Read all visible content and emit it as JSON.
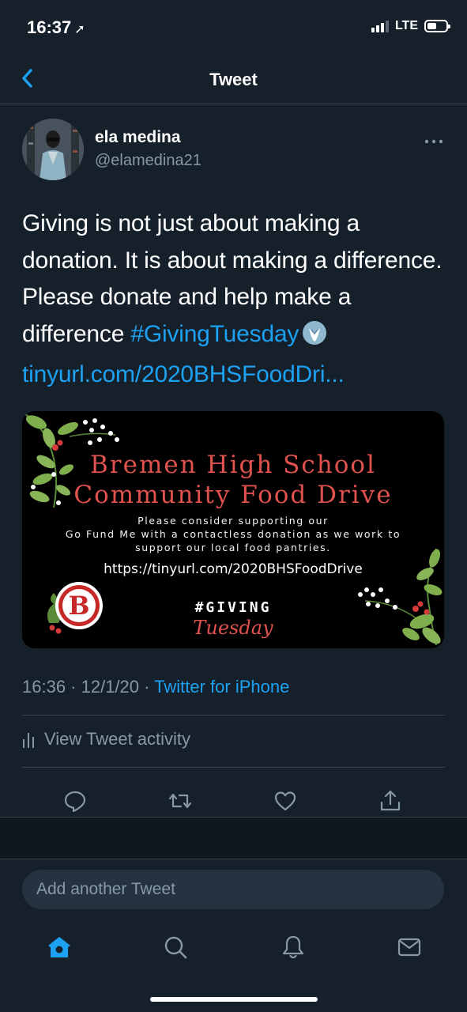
{
  "status_bar": {
    "time": "16:37",
    "network": "LTE"
  },
  "nav": {
    "title": "Tweet"
  },
  "tweet": {
    "author_name": "ela medina",
    "author_handle": "@elamedina21",
    "text_plain": "Giving is not just about making a donation. It is about making a difference. Please donate and help make a difference ",
    "hashtag": "#GivingTuesday",
    "link": "tinyurl.com/2020BHSFoodDri...",
    "timestamp": "16:36 · 12/1/20 · ",
    "source": "Twitter for iPhone",
    "activity_label": "View Tweet activity"
  },
  "media_card": {
    "headline_line1": "Bremen High School",
    "headline_line2": "Community Food Drive",
    "body_line1": "Please consider supporting our",
    "body_line2": "Go Fund Me with a contactless donation as we work to",
    "body_line3": "support our local food pantries.",
    "url": "https://tinyurl.com/2020BHSFoodDrive",
    "hashtag": "#GIVING",
    "tuesday": "Tuesday",
    "logo_letter": "B"
  },
  "reply": {
    "placeholder": "Add another Tweet"
  },
  "colors": {
    "background": "#15202b",
    "accent": "#1da1f2",
    "secondary_text": "#8899a6",
    "card_red": "#e0524e"
  },
  "icons": {
    "back": "chevron-left-icon",
    "more": "more-horizontal-icon",
    "reply": "reply-icon",
    "retweet": "retweet-icon",
    "like": "heart-icon",
    "share": "share-icon",
    "activity": "bar-chart-icon",
    "tab_home": "home-icon",
    "tab_search": "search-icon",
    "tab_notifications": "bell-icon",
    "tab_messages": "mail-icon"
  }
}
